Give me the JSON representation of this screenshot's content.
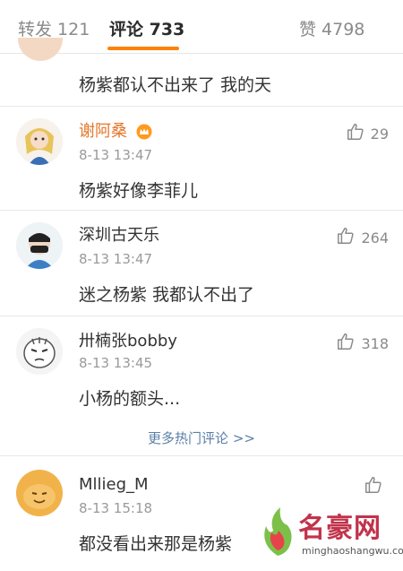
{
  "tabs": {
    "repost": "转发 121",
    "comments": "评论 733",
    "likes": "赞 4798"
  },
  "accent": "#ff8200",
  "cut_comment": {
    "text": "杨紫都认不出来了 我的天"
  },
  "comments": [
    {
      "user": "谢阿桑",
      "time": "8-13 13:47",
      "text": "杨紫好像李菲儿",
      "likes": "29",
      "vip": true
    },
    {
      "user": "深圳古天乐",
      "time": "8-13 13:47",
      "text": "迷之杨紫 我都认不出了",
      "likes": "264",
      "vip": false
    },
    {
      "user": "卅楠张bobby",
      "time": "8-13 13:45",
      "text": "小杨的额头...",
      "likes": "318",
      "vip": false
    },
    {
      "user": "Mllieg_M",
      "time": "8-13 15:18",
      "text": "都没看出来那是杨紫",
      "likes": "",
      "vip": false
    }
  ],
  "more_hot_comments": "更多热门评论 >>",
  "watermark": {
    "brand": "名豪网",
    "url": "minghaoshangwu.com"
  },
  "icons": {
    "like": "thumbs-up-icon",
    "vip": "crown-icon"
  }
}
